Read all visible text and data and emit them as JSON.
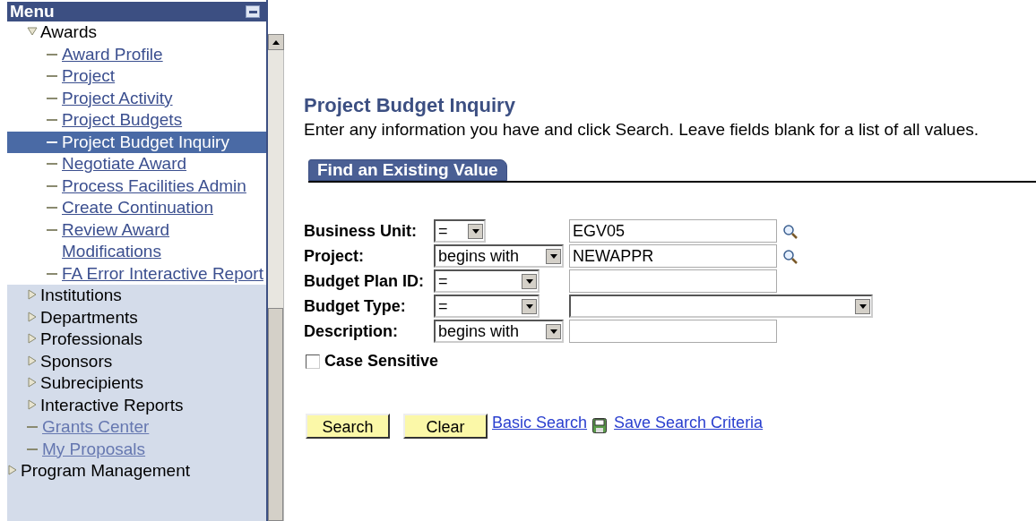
{
  "menu": {
    "title": "Menu",
    "items": [
      {
        "kind": "group",
        "children": [
          {
            "label": "Awards",
            "kind": "folder",
            "expanded": true,
            "children": [
              {
                "label": "Award Profile",
                "kind": "link",
                "selected": false
              },
              {
                "label": "Project",
                "kind": "link",
                "selected": false
              },
              {
                "label": "Project Activity",
                "kind": "link",
                "selected": false
              },
              {
                "label": "Project Budgets",
                "kind": "link",
                "selected": false
              },
              {
                "label": "Project Budget Inquiry",
                "kind": "link",
                "selected": true
              },
              {
                "label": "Negotiate Award",
                "kind": "link",
                "selected": false
              },
              {
                "label": "Process Facilities Admin",
                "kind": "link",
                "selected": false
              },
              {
                "label": "Create Continuation",
                "kind": "link",
                "selected": false
              },
              {
                "label": "Review Award Modifications",
                "kind": "link",
                "selected": false
              },
              {
                "label": "FA Error Interactive Report",
                "kind": "link",
                "selected": false
              }
            ]
          },
          {
            "label": "Institutions",
            "kind": "folder",
            "expanded": false
          },
          {
            "label": "Departments",
            "kind": "folder",
            "expanded": false
          },
          {
            "label": "Professionals",
            "kind": "folder",
            "expanded": false
          },
          {
            "label": "Sponsors",
            "kind": "folder",
            "expanded": false
          },
          {
            "label": "Subrecipients",
            "kind": "folder",
            "expanded": false
          },
          {
            "label": "Interactive Reports",
            "kind": "folder",
            "expanded": false
          },
          {
            "label": "Grants Center",
            "kind": "link",
            "selected": false
          },
          {
            "label": "My Proposals",
            "kind": "link",
            "selected": false
          }
        ]
      },
      {
        "label": "Program Management",
        "kind": "folder",
        "expanded": false
      }
    ]
  },
  "page": {
    "title": "Project Budget Inquiry",
    "instructions": "Enter any information you have and click Search. Leave fields blank for a list of all values.",
    "tabs": [
      {
        "label": "Find an Existing Value",
        "selected": true
      }
    ],
    "fields": [
      {
        "label": "Business Unit:",
        "operator": "=",
        "value": "EGV05",
        "kind": "text",
        "lookup": true
      },
      {
        "label": "Project:",
        "operator": "begins with",
        "value": "NEWAPPR",
        "kind": "text",
        "lookup": true
      },
      {
        "label": "Budget Plan ID:",
        "operator": "=",
        "kind": "text",
        "lookup": false
      },
      {
        "label": "Budget Type:",
        "operator": "=",
        "kind": "select",
        "lookup": false
      },
      {
        "label": "Description:",
        "operator": "begins with",
        "kind": "text",
        "lookup": false
      }
    ],
    "case_sensitive": {
      "label": "Case Sensitive",
      "checked": false
    },
    "buttons": [
      "Search",
      "Clear"
    ],
    "links": [
      {
        "label": "Basic Search",
        "kind": "plain"
      },
      {
        "label": "Save Search Criteria",
        "kind": "save"
      }
    ]
  }
}
